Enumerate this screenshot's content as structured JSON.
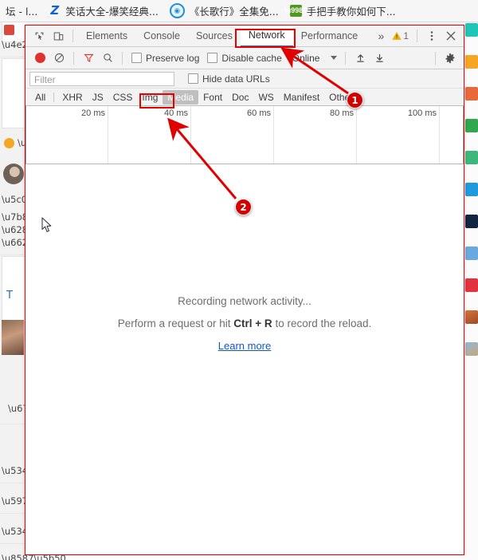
{
  "bookmarks": [
    {
      "icon": "none",
      "label": "坛 - l..."
    },
    {
      "icon": "zhihu-icon",
      "label": "笑话大全-爆笑经典..."
    },
    {
      "icon": "blue-circle-icon",
      "label": "《长歌行》全集免..."
    },
    {
      "icon": "green-square-icon",
      "label": "手把手教你如何下..."
    }
  ],
  "devtools": {
    "tabbar": {
      "inspect_icon": "inspect-element-icon",
      "device_icon": "device-toolbar-icon",
      "tabs": [
        {
          "label": "Elements",
          "selected": false
        },
        {
          "label": "Console",
          "selected": false
        },
        {
          "label": "Sources",
          "selected": false
        },
        {
          "label": "Network",
          "selected": true
        },
        {
          "label": "Performance",
          "selected": false
        }
      ],
      "overflow_label": "»",
      "warning_count": "1",
      "more_icon": "kebab-menu-icon",
      "close_icon": "close-icon"
    },
    "toolbar": {
      "record_icon": "record-stop-icon",
      "clear_icon": "clear-icon",
      "filter_icon": "filter-funnel-icon",
      "search_icon": "search-icon",
      "preserve_log_label": "Preserve log",
      "preserve_log_checked": false,
      "disable_cache_label": "Disable cache",
      "disable_cache_checked": false,
      "throttle_value": "Online",
      "import_icon": "import-har-icon",
      "export_icon": "export-har-icon",
      "settings_icon": "gear-icon"
    },
    "filterbar": {
      "filter_placeholder": "Filter",
      "filter_value": "",
      "hide_data_urls_label": "Hide data URLs",
      "hide_data_urls_checked": false
    },
    "type_filters": [
      {
        "label": "All",
        "active": false
      },
      {
        "label": "XHR",
        "active": false
      },
      {
        "label": "JS",
        "active": false
      },
      {
        "label": "CSS",
        "active": false
      },
      {
        "label": "Img",
        "active": false
      },
      {
        "label": "Media",
        "active": true
      },
      {
        "label": "Font",
        "active": false
      },
      {
        "label": "Doc",
        "active": false
      },
      {
        "label": "WS",
        "active": false
      },
      {
        "label": "Manifest",
        "active": false
      },
      {
        "label": "Other",
        "active": false
      }
    ],
    "timeline_ticks": [
      "20 ms",
      "40 ms",
      "60 ms",
      "80 ms",
      "100 ms"
    ],
    "empty_state": {
      "line1": "Recording network activity...",
      "line2_pre": "Perform a request or hit ",
      "line2_key": "Ctrl + R",
      "line2_post": " to record the reload.",
      "link": "Learn more"
    }
  },
  "annotations": {
    "marker1": "1",
    "marker2": "2",
    "color": "#e60000"
  }
}
